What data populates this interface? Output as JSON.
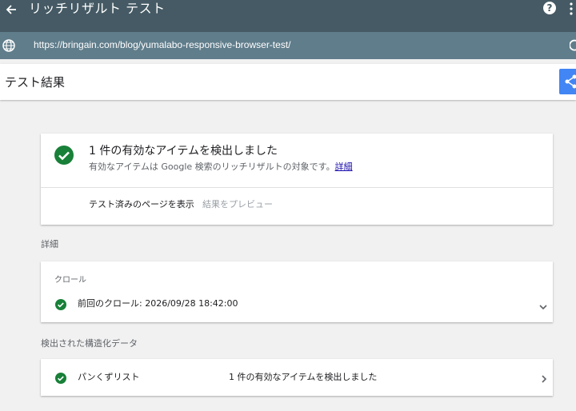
{
  "app": {
    "title": "リッチリザルト テスト"
  },
  "url_bar": {
    "url": "https://bringain.com/blog/yumalabo-responsive-browser-test/"
  },
  "page": {
    "title": "テスト結果"
  },
  "summary": {
    "title": "1 件の有効なアイテムを検出しました",
    "description": "有効なアイテムは Google 検索のリッチリザルトの対象です。",
    "detail_link": "詳細",
    "view_tested_page": "テスト済みのページを表示",
    "preview_results": "結果をプレビュー"
  },
  "details": {
    "section_label": "詳細",
    "crawl": {
      "heading": "クロール",
      "last_crawl": "前回のクロール: 2026/09/28 18:42:00"
    }
  },
  "structured_data": {
    "section_label": "検出された構造化データ",
    "items": [
      {
        "name": "パンくずリスト",
        "status": "1 件の有効なアイテムを検出しました"
      }
    ]
  },
  "colors": {
    "appbar": "#455a64",
    "urlbar": "#607d8b",
    "success": "#188038",
    "share": "#4285f4"
  },
  "icons": [
    "back-arrow-icon",
    "help-icon",
    "more-vert-icon",
    "globe-icon",
    "refresh-icon",
    "share-icon",
    "check-circle-icon",
    "chevron-down-icon",
    "chevron-right-icon"
  ]
}
